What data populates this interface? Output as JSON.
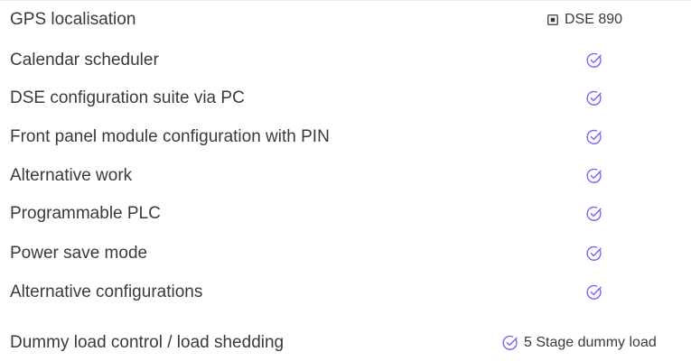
{
  "features": [
    {
      "label": "GPS localisation",
      "value_type": "checkbox-text",
      "value_text": "DSE 890",
      "icon": "checkbox-checked-icon"
    },
    {
      "label": "Calendar scheduler",
      "value_type": "check",
      "icon": "check-circle-icon"
    },
    {
      "label": "DSE configuration suite via PC",
      "value_type": "check",
      "icon": "check-circle-icon"
    },
    {
      "label": "Front panel module configuration with PIN",
      "value_type": "check",
      "icon": "check-circle-icon"
    },
    {
      "label": "Alternative work",
      "value_type": "check",
      "icon": "check-circle-icon"
    },
    {
      "label": "Programmable PLC",
      "value_type": "check",
      "icon": "check-circle-icon"
    },
    {
      "label": "Power save mode",
      "value_type": "check",
      "icon": "check-circle-icon"
    },
    {
      "label": "Alternative configurations",
      "value_type": "check",
      "icon": "check-circle-icon"
    },
    {
      "label": "Dummy load control / load shedding",
      "value_type": "check-text",
      "value_text": "5 Stage dummy load",
      "icon": "check-circle-icon"
    }
  ],
  "colors": {
    "check_icon": "#7b61ff",
    "text": "#3a3a3a",
    "checkbox_border": "#3a3a3a"
  }
}
